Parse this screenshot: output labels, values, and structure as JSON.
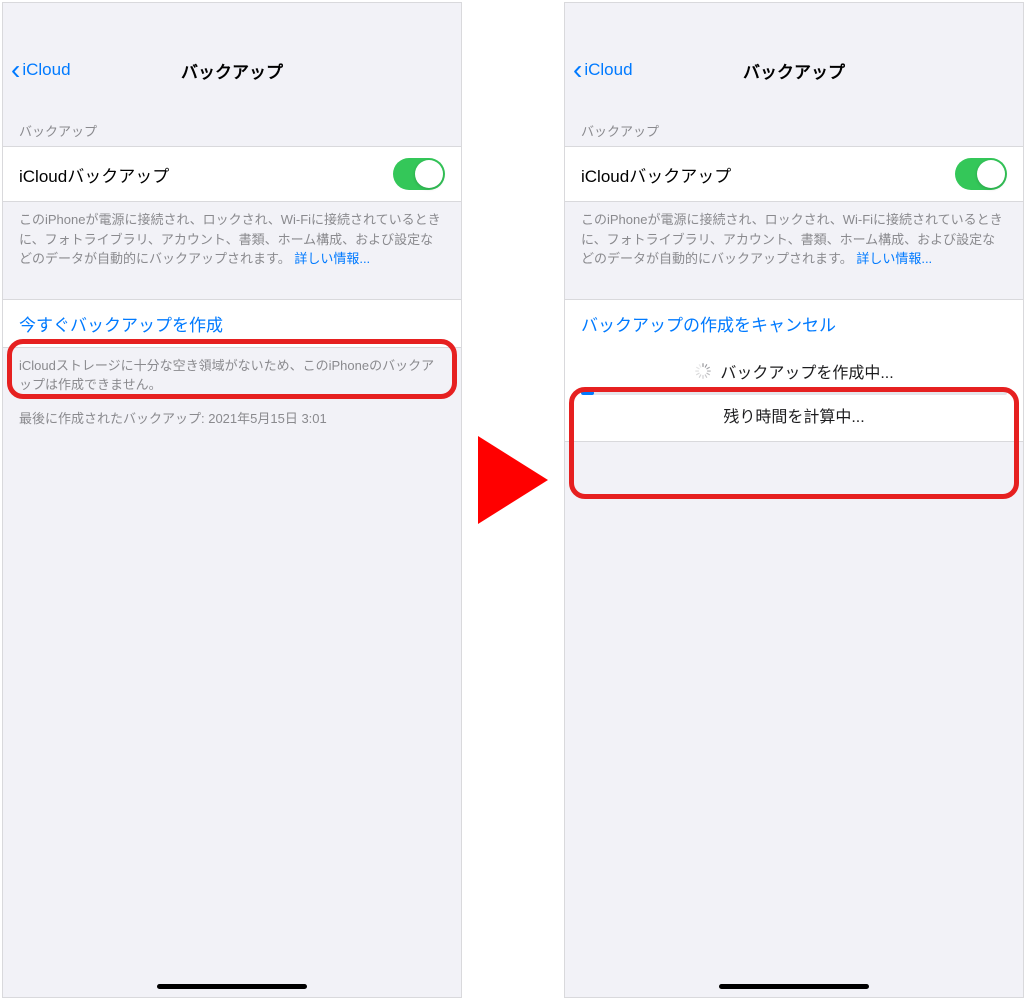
{
  "left": {
    "nav": {
      "back_label": "iCloud",
      "title": "バックアップ"
    },
    "section_header": "バックアップ",
    "toggle_row": {
      "label": "iCloudバックアップ"
    },
    "toggle_footer": {
      "text": "このiPhoneが電源に接続され、ロックされ、Wi-Fiに接続されているときに、フォトライブラリ、アカウント、書類、ホーム構成、および設定などのデータが自動的にバックアップされます。",
      "link": "詳しい情報..."
    },
    "action_row": {
      "label": "今すぐバックアップを作成"
    },
    "action_footer_1": "iCloudストレージに十分な空き領域がないため、このiPhoneのバックアップは作成できません。",
    "action_footer_2": "最後に作成されたバックアップ: 2021年5月15日 3:01"
  },
  "right": {
    "nav": {
      "back_label": "iCloud",
      "title": "バックアップ"
    },
    "section_header": "バックアップ",
    "toggle_row": {
      "label": "iCloudバックアップ"
    },
    "toggle_footer": {
      "text": "このiPhoneが電源に接続され、ロックされ、Wi-Fiに接続されているときに、フォトライブラリ、アカウント、書類、ホーム構成、および設定などのデータが自動的にバックアップされます。",
      "link": "詳しい情報..."
    },
    "cancel_row": {
      "label": "バックアップの作成をキャンセル"
    },
    "progress": {
      "title": "バックアップを作成中...",
      "subtitle": "残り時間を計算中...",
      "percent": 3
    }
  }
}
